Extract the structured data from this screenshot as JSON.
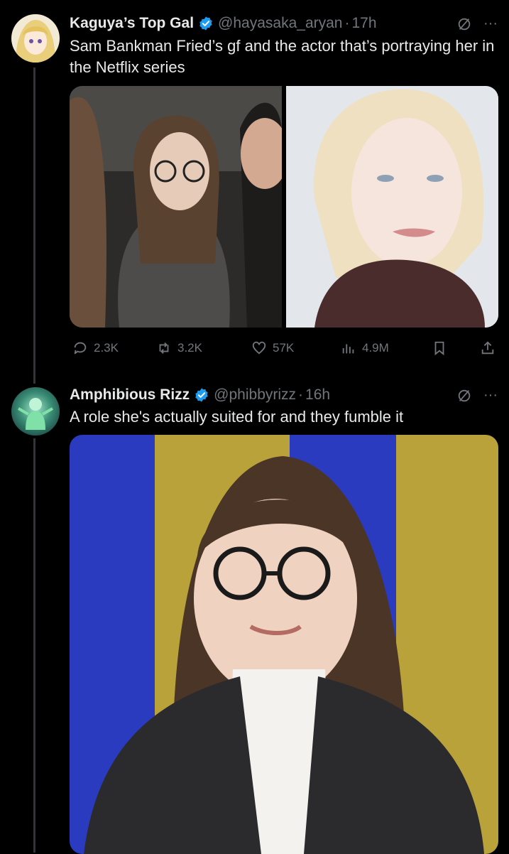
{
  "tweets": [
    {
      "name": "Kaguya’s Top Gal",
      "handle": "@hayasaka_aryan",
      "separator": "·",
      "time": "17h",
      "text": "Sam Bankman Fried’s gf and the actor that’s portraying her in the Netflix series",
      "actions": {
        "replies": "2.3K",
        "retweets": "3.2K",
        "likes": "57K",
        "views": "4.9M"
      }
    },
    {
      "name": "Amphibious Rizz",
      "handle": "@phibbyrizz",
      "separator": "·",
      "time": "16h",
      "text": "A role she's actually suited for and they fumble it"
    }
  ],
  "more_menu": "···",
  "colors": {
    "background": "#000000",
    "text": "#e7e9ea",
    "muted": "#71767b",
    "verified": "#1d9bf0"
  },
  "icons": [
    "grok-icon",
    "more-icon",
    "reply-icon",
    "retweet-icon",
    "like-icon",
    "views-icon",
    "bookmark-icon",
    "share-icon",
    "verified-badge-icon"
  ]
}
